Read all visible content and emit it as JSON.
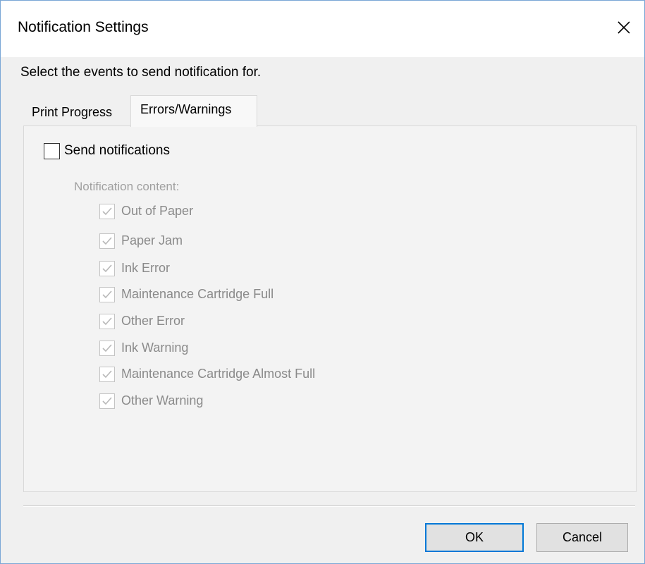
{
  "window": {
    "title": "Notification Settings",
    "close_icon": "close-icon",
    "accent_color": "#0078d7"
  },
  "instruction": "Select the events to send notification for.",
  "tabs": [
    {
      "label": "Print Progress",
      "selected": false
    },
    {
      "label": "Errors/Warnings",
      "selected": true
    }
  ],
  "send_notifications": {
    "label": "Send notifications",
    "checked": false
  },
  "content": {
    "caption": "Notification content:",
    "enabled": false,
    "options": [
      {
        "label": "Out of Paper",
        "checked": true
      },
      {
        "label": "Paper Jam",
        "checked": true
      },
      {
        "label": "Ink Error",
        "checked": true
      },
      {
        "label": "Maintenance Cartridge Full",
        "checked": true
      },
      {
        "label": "Other Error",
        "checked": true
      },
      {
        "label": "Ink Warning",
        "checked": true
      },
      {
        "label": "Maintenance Cartridge Almost Full",
        "checked": true
      },
      {
        "label": "Other Warning",
        "checked": true
      }
    ]
  },
  "buttons": {
    "ok": "OK",
    "cancel": "Cancel"
  }
}
